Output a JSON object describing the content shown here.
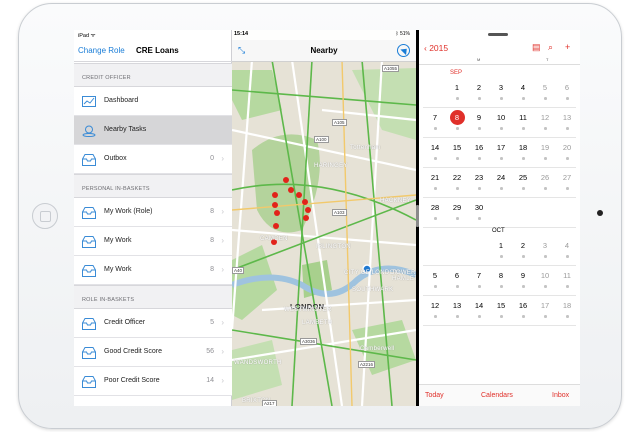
{
  "device": {
    "model": "iPad"
  },
  "left_status": {
    "carrier": "iPad ᯤ"
  },
  "sidebar": {
    "back_label": "Change Role",
    "title": "CRE Loans",
    "sections": [
      {
        "header": "CREDIT OFFICER",
        "items": [
          {
            "label": "Dashboard",
            "count": "",
            "icon": "dashboard-icon"
          },
          {
            "label": "Nearby Tasks",
            "count": "",
            "icon": "location-pin-icon",
            "selected": true
          },
          {
            "label": "Outbox",
            "count": "0",
            "icon": "tray-icon"
          }
        ]
      },
      {
        "header": "PERSONAL IN-BASKETS",
        "items": [
          {
            "label": "My Work (Role)",
            "count": "8",
            "icon": "tray-icon"
          },
          {
            "label": "My Work",
            "count": "8",
            "icon": "tray-icon"
          },
          {
            "label": "My Work",
            "count": "8",
            "icon": "tray-icon"
          }
        ]
      },
      {
        "header": "ROLE IN-BASKETS",
        "items": [
          {
            "label": "Credit Officer",
            "count": "5",
            "icon": "tray-icon"
          },
          {
            "label": "Good Credit Score",
            "count": "56",
            "icon": "tray-icon"
          },
          {
            "label": "Poor Credit Score",
            "count": "14",
            "icon": "tray-icon"
          }
        ]
      }
    ]
  },
  "map": {
    "time": "15:14",
    "status_right": "ᛒ 51%",
    "title": "Nearby",
    "labels": [
      "HARINGEY",
      "CAMDEN",
      "ISLINGTON",
      "HACKNEY",
      "LONDON",
      "CITY OF LONDON",
      "SOUTHWARK",
      "LAMBETH",
      "WESTMINSTER",
      "Tottenham",
      "Camberwell",
      "WANDSWORTH",
      "BRIXTON",
      "TOWER HAMLETS"
    ],
    "roads": [
      "A1055",
      "A105",
      "A100",
      "A103",
      "A3036",
      "A2216",
      "A217",
      "A215",
      "A40"
    ]
  },
  "calendar": {
    "year_label": "2015",
    "dow_labels": [
      "M",
      "T"
    ],
    "months": [
      {
        "name": "SEP",
        "weeks": [
          [
            "",
            "1",
            "2",
            "3",
            "4",
            "5",
            "6"
          ],
          [
            "7",
            "8",
            "9",
            "10",
            "11",
            "12",
            "13"
          ],
          [
            "14",
            "15",
            "16",
            "17",
            "18",
            "19",
            "20"
          ],
          [
            "21",
            "22",
            "23",
            "24",
            "25",
            "26",
            "27"
          ],
          [
            "28",
            "29",
            "30",
            "",
            "",
            "",
            ""
          ]
        ]
      },
      {
        "name": "OCT",
        "weeks": [
          [
            "",
            "",
            "",
            "1",
            "2",
            "3",
            "4"
          ],
          [
            "5",
            "6",
            "7",
            "8",
            "9",
            "10",
            "11"
          ],
          [
            "12",
            "13",
            "14",
            "15",
            "16",
            "17",
            "18"
          ]
        ]
      }
    ],
    "today": "8",
    "tabs": [
      "Today",
      "Calendars",
      "Inbox"
    ],
    "accent": "#e0302a"
  }
}
